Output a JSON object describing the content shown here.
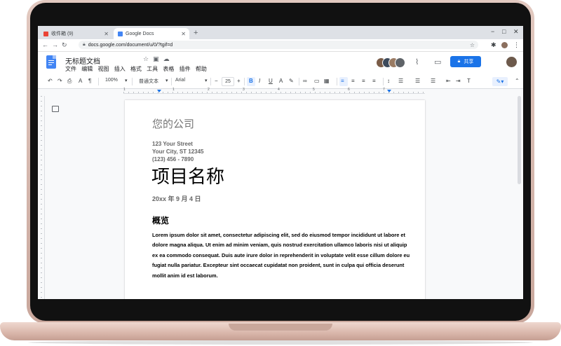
{
  "browser": {
    "tabs": [
      {
        "label": "收件箱 (9)",
        "active": false
      },
      {
        "label": "Google Docs",
        "active": true
      }
    ],
    "new_tab": "+",
    "url": "docs.google.com/document/u/0/?tgif=d",
    "window_controls": {
      "minimize": "−",
      "maximize": "□",
      "close": "✕"
    }
  },
  "docs": {
    "title": "无标题文档",
    "menu": [
      "文件",
      "编辑",
      "视图",
      "插入",
      "格式",
      "工具",
      "表格",
      "插件",
      "帮助"
    ],
    "share_label": "共享",
    "toolbar": {
      "zoom": "100%",
      "style": "普通文本",
      "font": "Arial",
      "font_size": "25"
    },
    "ruler_labels": [
      "1",
      "1",
      "2",
      "3",
      "4",
      "5",
      "6",
      "7"
    ]
  },
  "document": {
    "company": "您的公司",
    "address_lines": [
      "123 Your Street",
      "Your City, ST 12345",
      "(123) 456 - 7890"
    ],
    "project_name": "项目名称",
    "date": "20xx 年 9 月 4 日",
    "section_heading": "概览",
    "body_text": "Lorem ipsum dolor sit amet, consectetur adipiscing elit, sed do eiusmod tempor incididunt ut labore et dolore magna aliqua. Ut enim ad minim veniam, quis nostrud exercitation ullamco laboris nisi ut aliquip ex ea commodo consequat. Duis aute irure dolor in reprehenderit in voluptate velit esse cillum dolore eu fugiat nulla pariatur. Excepteur sint occaecat cupidatat non proident, sunt in culpa qui officia deserunt mollit anim id est laborum."
  },
  "colors": {
    "accent": "#1a73e8",
    "docs_blue": "#4285f4",
    "laptop": "#d9b6aa"
  },
  "icons": [
    "gmail-icon",
    "docs-icon",
    "back-icon",
    "forward-icon",
    "reload-icon",
    "lock-icon",
    "star-icon",
    "undo-icon",
    "redo-icon",
    "print-icon",
    "spellcheck-icon",
    "paint-format-icon",
    "bold-icon",
    "italic-icon",
    "underline-icon",
    "link-icon",
    "comment-icon",
    "image-icon",
    "align-left-icon",
    "pencil-icon"
  ]
}
